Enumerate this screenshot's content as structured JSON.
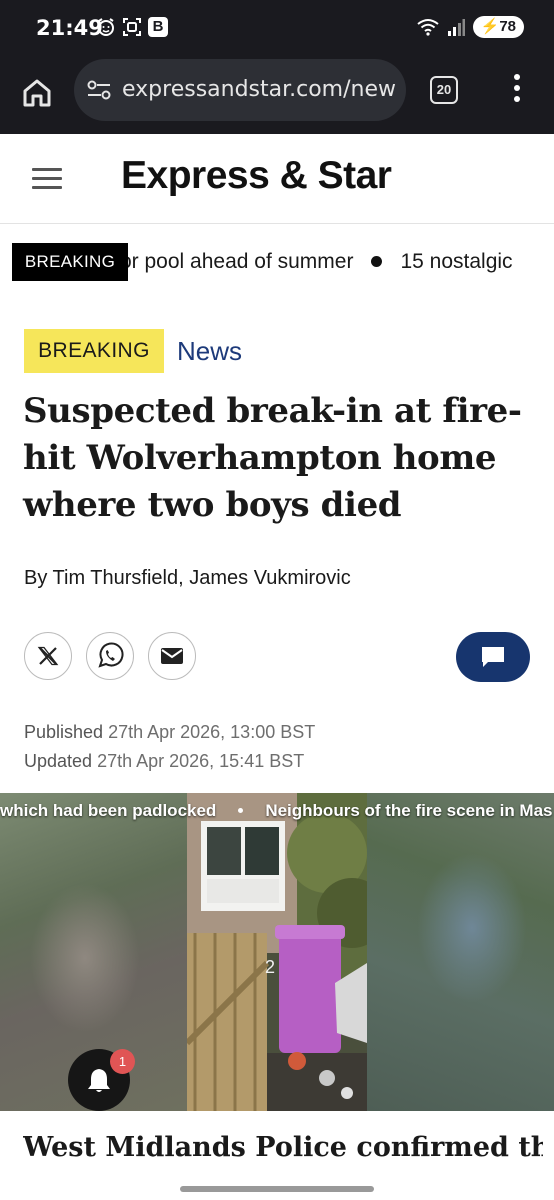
{
  "status_bar": {
    "time": "21:49",
    "badge": "B",
    "battery": "78"
  },
  "browser": {
    "url": "expressandstar.com/new",
    "tab_count": "20"
  },
  "site": {
    "logo": "Express & Star"
  },
  "ticker": {
    "label": "BREAKING",
    "items": [
      "or pool ahead of summer",
      "15 nostalgic"
    ]
  },
  "article": {
    "tag": "BREAKING",
    "section": "News",
    "headline": "Suspected break-in at fire-hit Wolverhampton home where two boys died",
    "byline": "By Tim Thursfield, James Vukmirovic",
    "published_label": "Published",
    "published_value": "27th Apr 2026, 13:00 BST",
    "updated_label": "Updated",
    "updated_value": "27th Apr 2026, 15:41 BST",
    "body_first_line": "West Midlands Police confirmed the"
  },
  "video": {
    "captions": [
      "which had been padlocked",
      "Neighbours of the fire scene in Mas"
    ],
    "door_number": "2"
  },
  "notifications": {
    "count": "1"
  },
  "icons": {
    "home": "home-icon",
    "tune": "site-settings-icon",
    "menu": "more-vert-icon",
    "hamburger": "hamburger-menu-icon",
    "x": "x-share-icon",
    "whatsapp": "whatsapp-share-icon",
    "email": "email-share-icon",
    "comments": "comments-icon",
    "bell": "notification-bell-icon"
  },
  "colors": {
    "breaking_tag": "#f6e65a",
    "section_link": "#1d3a7a",
    "comment_button": "#17356e",
    "badge": "#e05555"
  }
}
